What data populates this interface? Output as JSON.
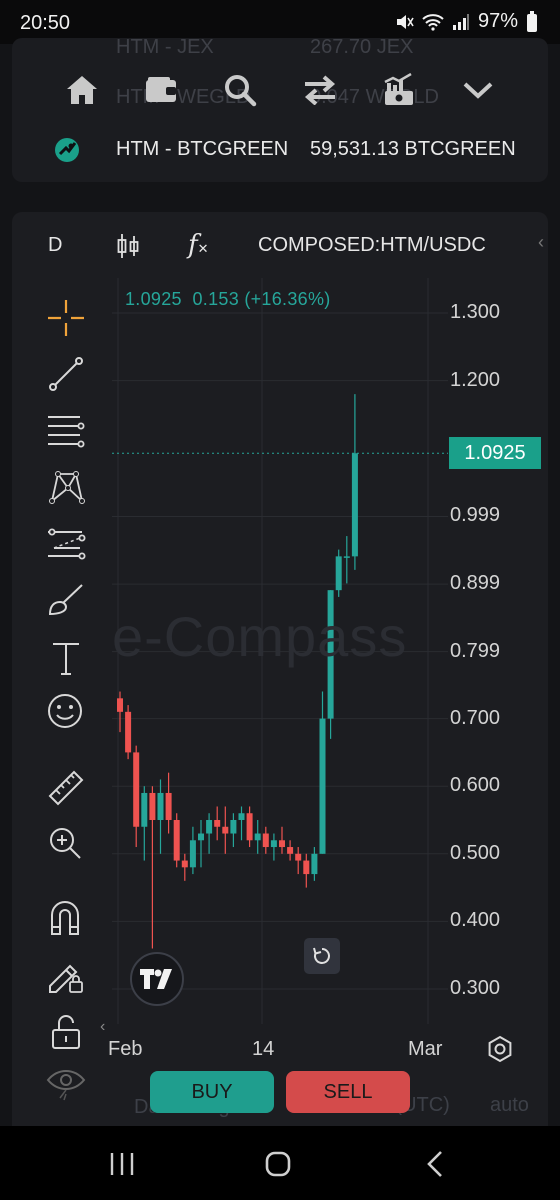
{
  "status_bar": {
    "time": "20:50",
    "battery": "97%"
  },
  "top_card": {
    "ghost_row_1": {
      "pair": "HTM - JEX",
      "value": "267.70 JEX"
    },
    "ghost_row_2": {
      "pair": "HTM - WEGLD",
      "value": "0.047 WEGLD"
    },
    "nav_icons": [
      "home-icon",
      "wallet-icon",
      "search-icon",
      "swap-icon",
      "chart-icon",
      "chevron-down-icon"
    ],
    "pair_row": {
      "pair": "HTM - BTCGREEN",
      "value": "59,531.13 BTCGREEN"
    }
  },
  "chart_toolbar": {
    "interval": "D",
    "indicator_glyph": "f",
    "symbol": "COMPOSED:HTM/USDC"
  },
  "legend": {
    "last": "1.0925",
    "change": "0.153",
    "change_pct": "(+16.36%)"
  },
  "watermark": "e-Compass",
  "price_tag": "1.0925",
  "side_tools": [
    "crosshair-icon",
    "trendline-icon",
    "horizontal-lines-icon",
    "pattern-icon",
    "projection-icon",
    "brush-icon",
    "text-icon",
    "emoji-icon",
    "ruler-icon",
    "zoom-in-icon",
    "magnet-icon",
    "lock-pencil-icon",
    "unlock-icon",
    "eye-icon"
  ],
  "x_labels": [
    "Feb",
    "14",
    "Mar"
  ],
  "footer": {
    "date_range": "Date Range",
    "time_utc": "20:50:10 (UTC)",
    "auto": "auto",
    "buy": "BUY",
    "sell": "SELL"
  },
  "colors": {
    "up": "#26a69a",
    "down": "#ef5350",
    "buy": "#1f9e8e",
    "sell": "#d44b4b"
  },
  "chart_data": {
    "type": "candlestick",
    "y_ticks": [
      "1.300",
      "1.200",
      "1.0925",
      "0.999",
      "0.899",
      "0.799",
      "0.700",
      "0.600",
      "0.500",
      "0.400",
      "0.300"
    ],
    "ylim": [
      0.26,
      1.34
    ],
    "x_ticks": [
      "Feb",
      "14",
      "Mar"
    ],
    "last_price": 1.0925,
    "candles": [
      {
        "o": 0.73,
        "h": 0.74,
        "l": 0.68,
        "c": 0.71
      },
      {
        "o": 0.71,
        "h": 0.72,
        "l": 0.64,
        "c": 0.65
      },
      {
        "o": 0.65,
        "h": 0.66,
        "l": 0.51,
        "c": 0.54
      },
      {
        "o": 0.54,
        "h": 0.6,
        "l": 0.49,
        "c": 0.59
      },
      {
        "o": 0.59,
        "h": 0.6,
        "l": 0.36,
        "c": 0.55
      },
      {
        "o": 0.55,
        "h": 0.61,
        "l": 0.5,
        "c": 0.59
      },
      {
        "o": 0.59,
        "h": 0.62,
        "l": 0.53,
        "c": 0.55
      },
      {
        "o": 0.55,
        "h": 0.56,
        "l": 0.48,
        "c": 0.49
      },
      {
        "o": 0.49,
        "h": 0.5,
        "l": 0.46,
        "c": 0.48
      },
      {
        "o": 0.48,
        "h": 0.54,
        "l": 0.47,
        "c": 0.52
      },
      {
        "o": 0.52,
        "h": 0.55,
        "l": 0.48,
        "c": 0.53
      },
      {
        "o": 0.53,
        "h": 0.56,
        "l": 0.5,
        "c": 0.55
      },
      {
        "o": 0.55,
        "h": 0.57,
        "l": 0.52,
        "c": 0.54
      },
      {
        "o": 0.54,
        "h": 0.57,
        "l": 0.5,
        "c": 0.53
      },
      {
        "o": 0.53,
        "h": 0.56,
        "l": 0.51,
        "c": 0.55
      },
      {
        "o": 0.55,
        "h": 0.57,
        "l": 0.52,
        "c": 0.56
      },
      {
        "o": 0.56,
        "h": 0.57,
        "l": 0.51,
        "c": 0.52
      },
      {
        "o": 0.52,
        "h": 0.55,
        "l": 0.5,
        "c": 0.53
      },
      {
        "o": 0.53,
        "h": 0.54,
        "l": 0.5,
        "c": 0.51
      },
      {
        "o": 0.51,
        "h": 0.53,
        "l": 0.49,
        "c": 0.52
      },
      {
        "o": 0.52,
        "h": 0.54,
        "l": 0.5,
        "c": 0.51
      },
      {
        "o": 0.51,
        "h": 0.52,
        "l": 0.49,
        "c": 0.5
      },
      {
        "o": 0.5,
        "h": 0.51,
        "l": 0.47,
        "c": 0.49
      },
      {
        "o": 0.49,
        "h": 0.5,
        "l": 0.45,
        "c": 0.47
      },
      {
        "o": 0.47,
        "h": 0.51,
        "l": 0.46,
        "c": 0.5
      },
      {
        "o": 0.5,
        "h": 0.74,
        "l": 0.5,
        "c": 0.7
      },
      {
        "o": 0.7,
        "h": 0.89,
        "l": 0.67,
        "c": 0.89
      },
      {
        "o": 0.89,
        "h": 0.95,
        "l": 0.88,
        "c": 0.94
      },
      {
        "o": 0.94,
        "h": 0.97,
        "l": 0.9,
        "c": 0.94
      },
      {
        "o": 0.94,
        "h": 1.18,
        "l": 0.92,
        "c": 1.0925
      }
    ]
  }
}
